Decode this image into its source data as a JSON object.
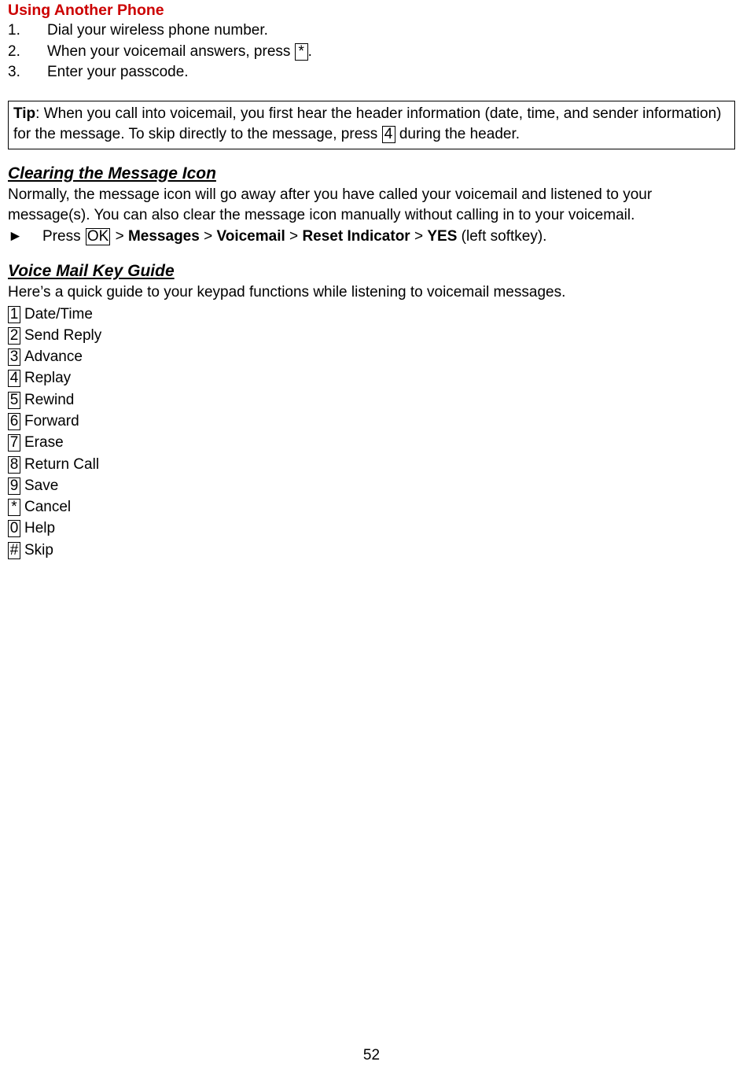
{
  "document": {
    "page_number": "52",
    "sections": [
      {
        "heading": "Using Another Phone",
        "steps": [
          {
            "num": "1.",
            "pre": "Dial your wireless phone number.",
            "key": "",
            "post": ""
          },
          {
            "num": "2.",
            "pre": "When your voicemail answers, press ",
            "key": "*",
            "post": "."
          },
          {
            "num": "3.",
            "pre": "Enter your passcode.",
            "key": "",
            "post": ""
          }
        ]
      }
    ],
    "tip": {
      "label": "Tip",
      "text_before_key": ": When you call into voicemail, you first hear the header information (date, time, and sender information) for the message. To skip directly to the message, press ",
      "key": "4",
      "text_after_key": " during the header."
    },
    "clearing": {
      "heading": "Clearing the Message Icon",
      "paragraph": "Normally, the message icon will go away after you have called your voicemail and listened to your message(s). You can also clear the message icon manually without calling in to your voicemail.",
      "arrow": "►",
      "press_label": "Press ",
      "ok_key": "OK",
      "sep1": " > ",
      "item1": "Messages",
      "sep2": " > ",
      "item2": "Voicemail",
      "sep3": " > ",
      "item3": "Reset Indicator",
      "sep4": " > ",
      "item4": "YES",
      "trailing": " (left softkey)."
    },
    "voice_mail_key_guide": {
      "heading": "Voice Mail Key Guide",
      "intro": "Here’s a quick guide to your keypad functions while listening to voicemail messages.",
      "entries": [
        {
          "key": "1",
          "label": "Date/Time"
        },
        {
          "key": "2",
          "label": "Send Reply"
        },
        {
          "key": "3",
          "label": "Advance"
        },
        {
          "key": "4",
          "label": "Replay"
        },
        {
          "key": "5",
          "label": "Rewind"
        },
        {
          "key": "6",
          "label": "Forward"
        },
        {
          "key": "7",
          "label": "Erase"
        },
        {
          "key": "8",
          "label": "Return Call"
        },
        {
          "key": "9",
          "label": "Save"
        },
        {
          "key": "*",
          "label": "Cancel"
        },
        {
          "key": "0",
          "label": "Help"
        },
        {
          "key": "#",
          "label": "Skip"
        }
      ]
    },
    "colors": {
      "heading_red": "#cc0000",
      "text": "#000000",
      "background": "#ffffff"
    }
  }
}
